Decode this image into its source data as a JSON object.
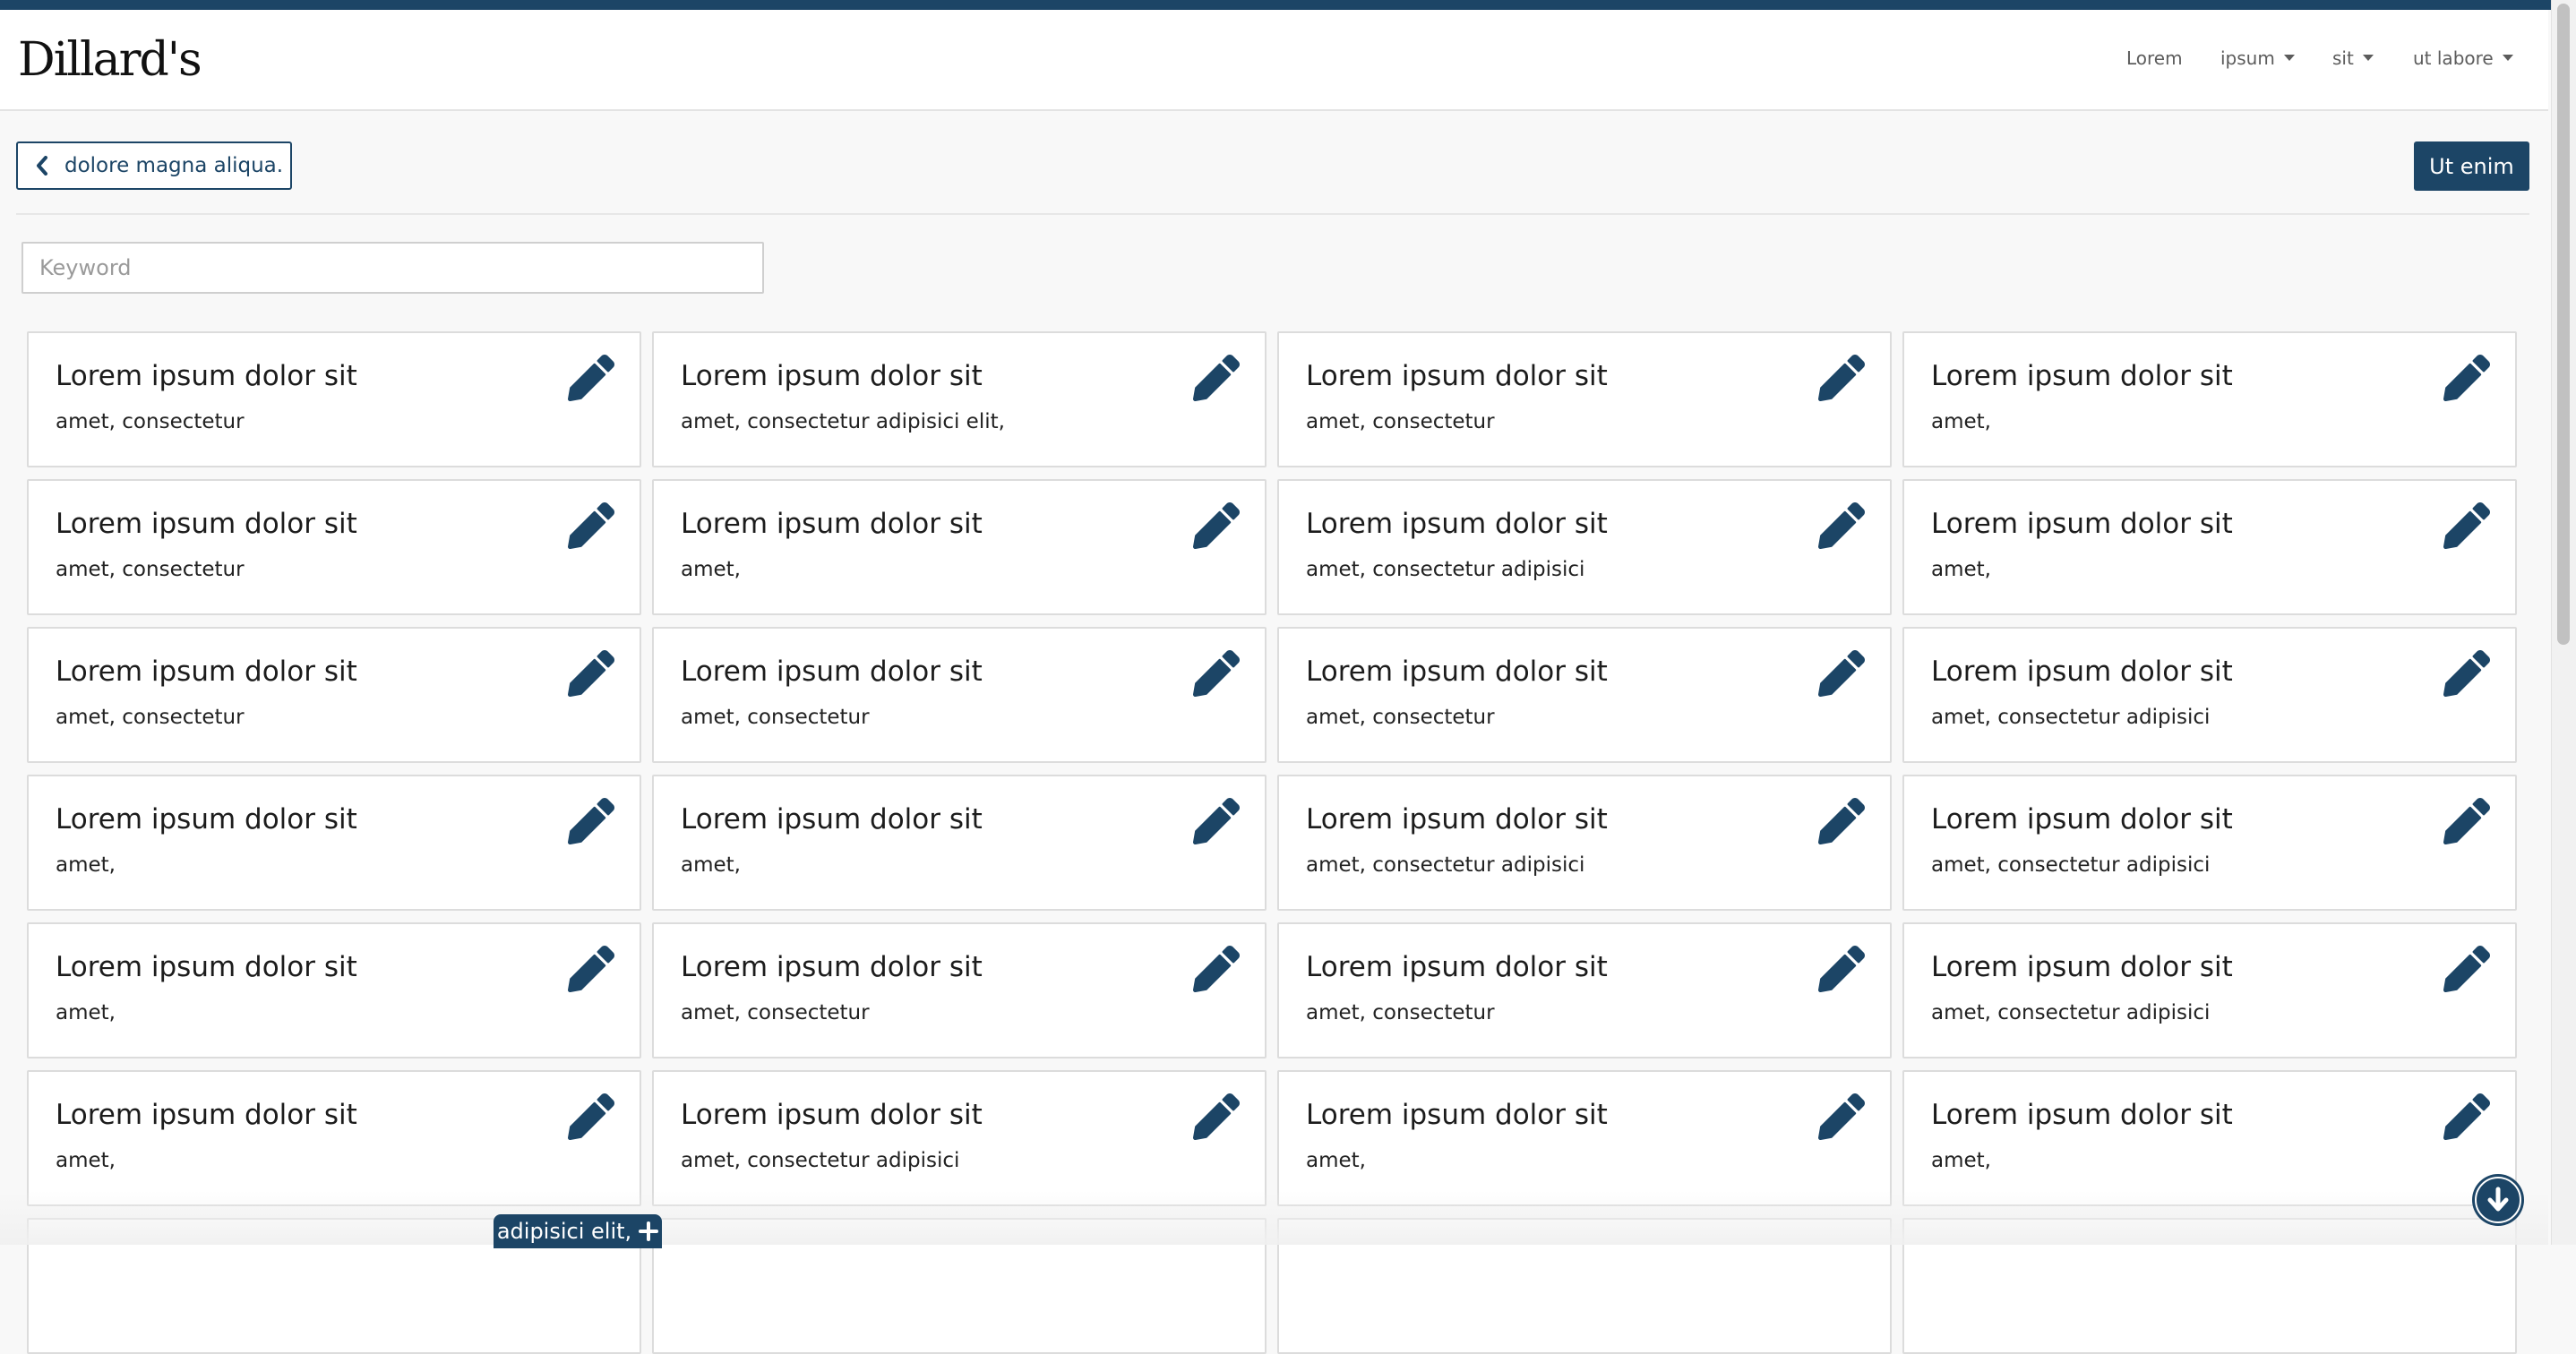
{
  "header": {
    "logo": "Dillard's",
    "nav": [
      {
        "label": "Lorem",
        "dropdown": false
      },
      {
        "label": "ipsum",
        "dropdown": true
      },
      {
        "label": "sit",
        "dropdown": true
      },
      {
        "label": "ut labore",
        "dropdown": true
      }
    ]
  },
  "toolbar": {
    "back_label": "dolore magna aliqua.",
    "primary_label": "Ut enim"
  },
  "search": {
    "placeholder": "Keyword",
    "value": ""
  },
  "cards": [
    {
      "title": "Lorem ipsum dolor sit",
      "subtitle": "amet, consectetur"
    },
    {
      "title": "Lorem ipsum dolor sit",
      "subtitle": "amet, consectetur adipisici elit,"
    },
    {
      "title": "Lorem ipsum dolor sit",
      "subtitle": "amet, consectetur"
    },
    {
      "title": "Lorem ipsum dolor sit",
      "subtitle": "amet,"
    },
    {
      "title": "Lorem ipsum dolor sit",
      "subtitle": "amet, consectetur"
    },
    {
      "title": "Lorem ipsum dolor sit",
      "subtitle": "amet,"
    },
    {
      "title": "Lorem ipsum dolor sit",
      "subtitle": "amet, consectetur adipisici"
    },
    {
      "title": "Lorem ipsum dolor sit",
      "subtitle": "amet,"
    },
    {
      "title": "Lorem ipsum dolor sit",
      "subtitle": "amet, consectetur"
    },
    {
      "title": "Lorem ipsum dolor sit",
      "subtitle": "amet, consectetur"
    },
    {
      "title": "Lorem ipsum dolor sit",
      "subtitle": "amet, consectetur"
    },
    {
      "title": "Lorem ipsum dolor sit",
      "subtitle": "amet, consectetur adipisici"
    },
    {
      "title": "Lorem ipsum dolor sit",
      "subtitle": "amet,"
    },
    {
      "title": "Lorem ipsum dolor sit",
      "subtitle": "amet,"
    },
    {
      "title": "Lorem ipsum dolor sit",
      "subtitle": "amet, consectetur adipisici"
    },
    {
      "title": "Lorem ipsum dolor sit",
      "subtitle": "amet, consectetur adipisici"
    },
    {
      "title": "Lorem ipsum dolor sit",
      "subtitle": "amet,"
    },
    {
      "title": "Lorem ipsum dolor sit",
      "subtitle": "amet, consectetur"
    },
    {
      "title": "Lorem ipsum dolor sit",
      "subtitle": "amet, consectetur"
    },
    {
      "title": "Lorem ipsum dolor sit",
      "subtitle": "amet, consectetur adipisici"
    },
    {
      "title": "Lorem ipsum dolor sit",
      "subtitle": "amet,"
    },
    {
      "title": "Lorem ipsum dolor sit",
      "subtitle": "amet, consectetur adipisici"
    },
    {
      "title": "Lorem ipsum dolor sit",
      "subtitle": "amet,"
    },
    {
      "title": "Lorem ipsum dolor sit",
      "subtitle": "amet,"
    },
    {
      "title": "",
      "subtitle": ""
    },
    {
      "title": "",
      "subtitle": ""
    },
    {
      "title": "",
      "subtitle": ""
    },
    {
      "title": "",
      "subtitle": ""
    }
  ],
  "floating": {
    "add_label": "adipisici elit,",
    "add_icon": "plus-icon",
    "scroll_icon": "arrow-down-circle-icon"
  },
  "theme": {
    "accent": "#1c4566",
    "card_border": "#dcdcdc",
    "background": "#f8f8f8"
  }
}
